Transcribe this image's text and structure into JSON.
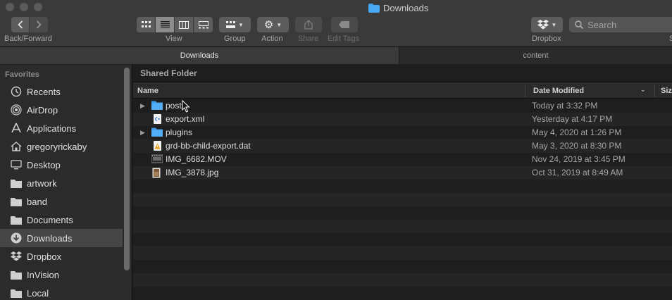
{
  "window": {
    "title": "Downloads"
  },
  "toolbar": {
    "back_forward_label": "Back/Forward",
    "view_label": "View",
    "group_label": "Group",
    "action_label": "Action",
    "share_label": "Share",
    "edit_tags_label": "Edit Tags",
    "dropbox_label": "Dropbox",
    "search_placeholder": "Search",
    "truncated_label": "S"
  },
  "tabs": [
    {
      "label": "Downloads",
      "active": true
    },
    {
      "label": "content",
      "active": false
    }
  ],
  "sidebar": {
    "heading": "Favorites",
    "items": [
      {
        "label": "Recents",
        "icon": "clock-icon"
      },
      {
        "label": "AirDrop",
        "icon": "airdrop-icon"
      },
      {
        "label": "Applications",
        "icon": "applications-icon"
      },
      {
        "label": "gregoryrickaby",
        "icon": "home-icon"
      },
      {
        "label": "Desktop",
        "icon": "desktop-icon"
      },
      {
        "label": "artwork",
        "icon": "folder-icon"
      },
      {
        "label": "band",
        "icon": "folder-icon"
      },
      {
        "label": "Documents",
        "icon": "folder-icon"
      },
      {
        "label": "Downloads",
        "icon": "download-icon",
        "selected": true
      },
      {
        "label": "Dropbox",
        "icon": "dropbox-icon"
      },
      {
        "label": "InVision",
        "icon": "folder-icon"
      },
      {
        "label": "Local",
        "icon": "folder-icon"
      }
    ]
  },
  "content": {
    "shared_folder_label": "Shared Folder",
    "columns": {
      "name": "Name",
      "date_modified": "Date Modified",
      "size": "Siz"
    },
    "files": [
      {
        "name": "posts",
        "date": "Today at 3:32 PM",
        "kind": "folder",
        "expandable": true
      },
      {
        "name": "export.xml",
        "date": "Yesterday at 4:17 PM",
        "kind": "xml",
        "expandable": false
      },
      {
        "name": "plugins",
        "date": "May 4, 2020 at 1:26 PM",
        "kind": "folder",
        "expandable": true
      },
      {
        "name": "grd-bb-child-export.dat",
        "date": "May 3, 2020 at 8:30 PM",
        "kind": "dat",
        "expandable": false
      },
      {
        "name": "IMG_6682.MOV",
        "date": "Nov 24, 2019 at 3:45 PM",
        "kind": "movie",
        "expandable": false
      },
      {
        "name": "IMG_3878.jpg",
        "date": "Oct 31, 2019 at 8:49 AM",
        "kind": "image",
        "expandable": false
      }
    ]
  },
  "colors": {
    "folder_blue": "#4aa8f2",
    "toolbar_bg": "#3a3a3a",
    "selection_bg": "#464646"
  }
}
